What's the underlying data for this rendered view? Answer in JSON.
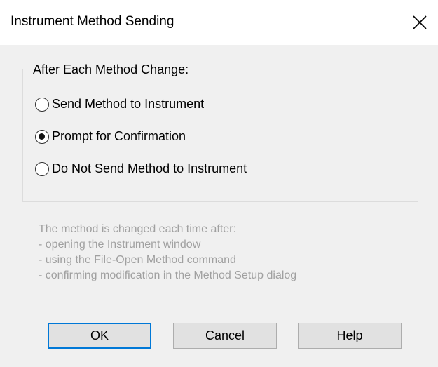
{
  "window": {
    "title": "Instrument Method Sending"
  },
  "group": {
    "legend": "After Each Method Change:",
    "options": [
      {
        "label": "Send Method to Instrument",
        "checked": false
      },
      {
        "label": "Prompt for Confirmation",
        "checked": true
      },
      {
        "label": "Do Not Send Method to Instrument",
        "checked": false
      }
    ]
  },
  "info": {
    "lines": [
      "The method is changed each time after:",
      " - opening the Instrument window",
      " - using the File-Open Method command",
      " - confirming modification in the Method Setup dialog"
    ]
  },
  "buttons": {
    "ok": "OK",
    "cancel": "Cancel",
    "help": "Help"
  },
  "colors": {
    "background": "#f0f0f0",
    "titlebar": "#ffffff",
    "info_text": "#a0a0a0",
    "default_button_border": "#0078d7"
  },
  "icons": {
    "close": "close-icon"
  }
}
